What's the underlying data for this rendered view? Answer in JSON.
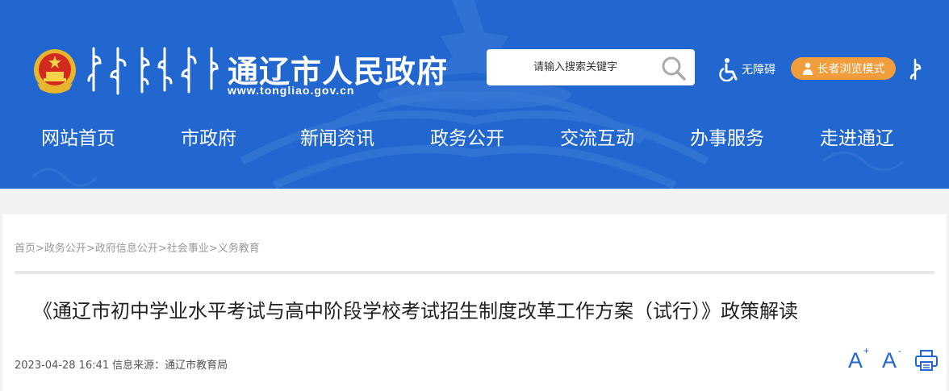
{
  "header": {
    "site_title": "通辽市人民政府",
    "site_url": "www.tongliao.gov.cn",
    "search": {
      "placeholder": "请输入搜索关键字"
    },
    "accessibility_label": "无障碍",
    "elder_mode_label": "长者浏览模式",
    "brand_color": "#2266cf",
    "accent_color": "#f19d3b"
  },
  "nav": {
    "items": [
      {
        "label": "网站首页"
      },
      {
        "label": "市政府"
      },
      {
        "label": "新闻资讯"
      },
      {
        "label": "政务公开"
      },
      {
        "label": "交流互动"
      },
      {
        "label": "办事服务"
      },
      {
        "label": "走进通辽"
      }
    ]
  },
  "breadcrumb": {
    "items": [
      "首页",
      "政务公开",
      "政府信息公开",
      "社会事业",
      "义务教育"
    ],
    "separator": ">"
  },
  "article": {
    "title": "《通辽市初中学业水平考试与高中阶段学校考试招生制度改革工作方案（试行）》政策解读",
    "date": "2023-04-28 16:41",
    "source_label": "信息来源：",
    "source": "通辽市教育局"
  },
  "tools": {
    "font_increase": "A",
    "font_increase_mark": "+",
    "font_decrease": "A",
    "font_decrease_mark": "-"
  },
  "icons": {
    "emblem": "national-emblem-icon",
    "search": "search-icon",
    "accessibility": "wheelchair-icon",
    "elder": "elder-person-icon",
    "mongolian": "mongolian-script-icon",
    "print": "print-icon"
  }
}
